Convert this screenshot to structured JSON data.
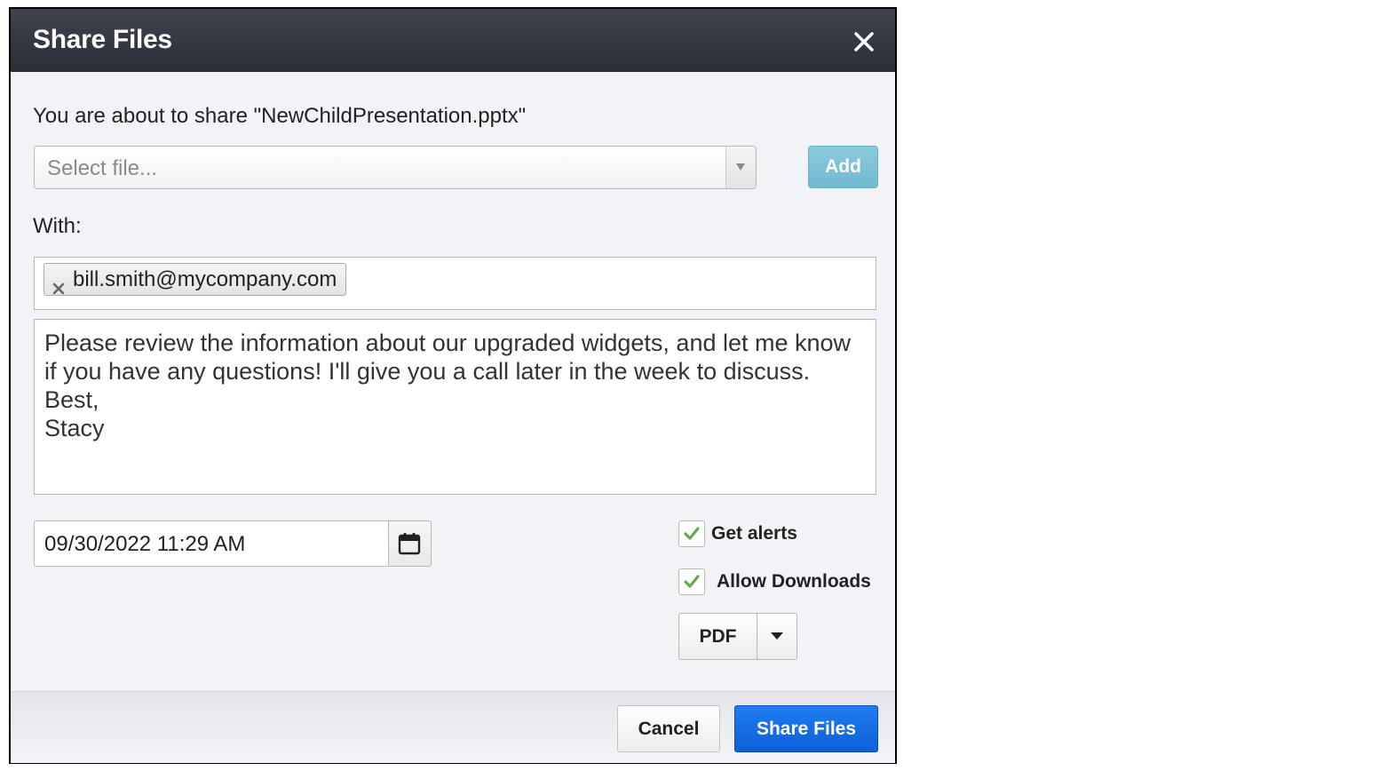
{
  "dialog": {
    "title": "Share Files",
    "close_icon": "close-icon"
  },
  "share": {
    "intro": "You are about to share \"NewChildPresentation.pptx\"",
    "file_select": {
      "placeholder": "Select file...",
      "arrow_icon": "chevron-down-icon"
    },
    "add_label": "Add"
  },
  "recipients": {
    "label": "With:",
    "chips": [
      {
        "email": "bill.smith@mycompany.com",
        "remove_icon": "close-icon"
      }
    ]
  },
  "message": {
    "text": "Please review the information about our upgraded widgets, and let me know if you have any questions! I'll give you a call later in the week to discuss.\nBest,\nStacy"
  },
  "expiration": {
    "value": "09/30/2022 11:29 AM",
    "calendar_icon": "calendar-icon"
  },
  "options": {
    "get_alerts": {
      "label": "Get alerts",
      "checked": true
    },
    "allow_downloads": {
      "label": "Allow Downloads",
      "checked": true
    },
    "format": {
      "selected": "PDF",
      "caret_icon": "caret-down-icon"
    }
  },
  "footer": {
    "cancel_label": "Cancel",
    "share_label": "Share Files"
  },
  "colors": {
    "titlebar": "#2f323a",
    "primary": "#1a6fe6",
    "add_button": "#7fc1d7",
    "check": "#6aa84f"
  }
}
